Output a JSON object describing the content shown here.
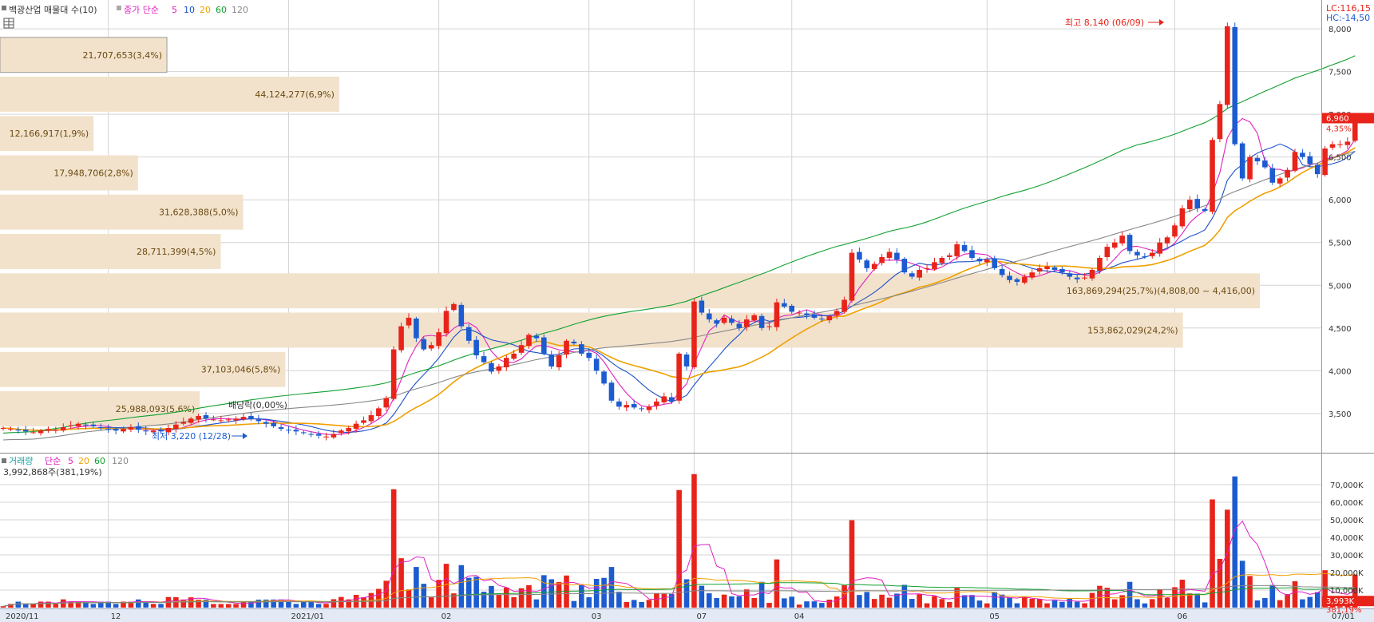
{
  "header": {
    "title": "백광산업 매물대 수(10)",
    "ma_label": "종가 단순",
    "ma_periods": [
      "5",
      "10",
      "20",
      "60",
      "120"
    ],
    "ma_colors": [
      "#e020c0",
      "#1e50c8",
      "#f0a000",
      "#10a030",
      "#888888"
    ]
  },
  "volume_header": {
    "title": "거래량",
    "ma_label": "단순",
    "ma_periods": [
      "5",
      "20",
      "60",
      "120"
    ],
    "value_text": "3,992,868주(381,19%)"
  },
  "right_info": {
    "lc": "LC:116,15",
    "hc": "HC:-14,50",
    "last_price": "6,960",
    "last_change": "4,35%",
    "last_volume": "3,993K",
    "last_volume_pct": "381,19%"
  },
  "annotations": {
    "high": "최고 8,140 (06/09)",
    "low": "최저 3,220 (12/28)",
    "dividend": "배당락(0,00%)"
  },
  "colors": {
    "up": "#e8231a",
    "down": "#1c5bd0",
    "profile": "#f2e2cc",
    "grid": "#d4d4d4",
    "axis_bg": "#ffffff",
    "bottom_axis_bg": "#e4eaf5"
  },
  "chart_data": [
    {
      "type": "candlestick",
      "title": "백광산업 매물대 수(10)",
      "x_labels": [
        "2020/11",
        "12",
        "2021/01",
        "02",
        "03",
        "04",
        "05",
        "06",
        "07",
        "07/01"
      ],
      "y_ticks": [
        "3,500",
        "4,000",
        "4,500",
        "5,000",
        "5,500",
        "6,000",
        "6,500",
        "7,000",
        "7,500",
        "8,000"
      ],
      "ylim": [
        3050,
        8300
      ],
      "close": [
        3330,
        3320,
        3300,
        3290,
        3280,
        3300,
        3320,
        3310,
        3340,
        3360,
        3380,
        3360,
        3350,
        3330,
        3310,
        3300,
        3320,
        3340,
        3310,
        3290,
        3300,
        3290,
        3330,
        3370,
        3400,
        3440,
        3470,
        3440,
        3430,
        3420,
        3430,
        3440,
        3460,
        3440,
        3410,
        3380,
        3350,
        3320,
        3300,
        3290,
        3270,
        3250,
        3240,
        3230,
        3260,
        3300,
        3330,
        3380,
        3420,
        3480,
        3560,
        3680,
        4250,
        4520,
        4620,
        4380,
        4250,
        4300,
        4450,
        4700,
        4780,
        4520,
        4350,
        4180,
        4100,
        3990,
        4050,
        4150,
        4200,
        4300,
        4420,
        4380,
        4200,
        4050,
        4180,
        4350,
        4320,
        4200,
        4150,
        4000,
        3850,
        3650,
        3580,
        3600,
        3570,
        3550,
        3580,
        3640,
        3700,
        3640,
        4200,
        4050,
        4810,
        4680,
        4600,
        4550,
        4620,
        4560,
        4500,
        4600,
        4650,
        4500,
        4520,
        4800,
        4750,
        4690,
        4680,
        4650,
        4620,
        4600,
        4640,
        4700,
        4830,
        5380,
        5300,
        5200,
        5250,
        5330,
        5390,
        5300,
        5150,
        5100,
        5180,
        5200,
        5270,
        5320,
        5350,
        5480,
        5400,
        5320,
        5280,
        5300,
        5200,
        5120,
        5060,
        5040,
        5100,
        5150,
        5200,
        5220,
        5180,
        5150,
        5100,
        5070,
        5090,
        5180,
        5320,
        5450,
        5500,
        5580,
        5400,
        5350,
        5330,
        5380,
        5500,
        5560,
        5700,
        5900,
        6000,
        5900,
        5870,
        6700,
        7120,
        8030,
        6650,
        6250,
        6500,
        6450,
        6380,
        6200,
        6250,
        6350,
        6560,
        6500,
        6420,
        6300,
        6600,
        6650,
        6650,
        6680,
        6960
      ],
      "candle_count": 173,
      "price_levels": [
        {
          "text": "21,707,653(3,4%)",
          "volume": 21707653
        },
        {
          "text": "44,124,277(6,9%)",
          "volume": 44124277
        },
        {
          "text": "12,166,917(1,9%)",
          "volume": 12166917
        },
        {
          "text": "17,948,706(2,8%)",
          "volume": 17948706
        },
        {
          "text": "31,628,388(5,0%)",
          "volume": 31628388
        },
        {
          "text": "28,711,399(4,5%)",
          "volume": 28711399
        },
        {
          "text": "163,869,294(25,7%)(4,808,00 ~ 4,416,00)",
          "volume": 163869294
        },
        {
          "text": "153,862,029(24,2%)",
          "volume": 153862029
        },
        {
          "text": "37,103,046(5,8%)",
          "volume": 37103046
        },
        {
          "text": "25,988,093(5,6%)",
          "volume": 25988093
        }
      ]
    },
    {
      "type": "bar",
      "title": "거래량",
      "y_ticks": [
        "10,000K",
        "20,000K",
        "30,000K",
        "40,000K",
        "50,000K",
        "60,000K",
        "70,000K"
      ],
      "ylim": [
        0,
        80000
      ],
      "unit": "K"
    }
  ]
}
